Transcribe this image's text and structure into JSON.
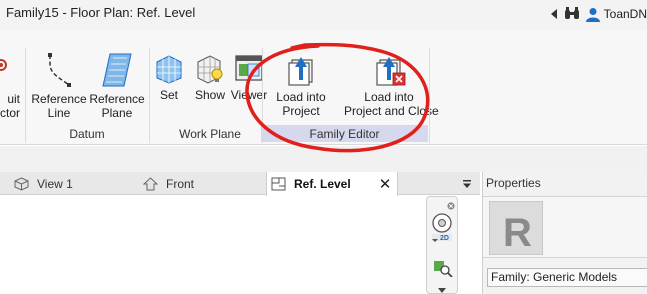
{
  "titlebar": {
    "title": "Family15 - Floor Plan: Ref. Level",
    "user_name": "ToanDN"
  },
  "ribbon": {
    "buttons": {
      "partial_a": "uit",
      "partial_b": "ctor",
      "reference_line": [
        "Reference",
        "Line"
      ],
      "reference_plane": [
        "Reference",
        "Plane"
      ],
      "set": "Set",
      "show": "Show",
      "viewer": "Viewer",
      "load_into_project": [
        "Load into",
        "Project"
      ],
      "load_into_project_and_close": [
        "Load into",
        "Project and Close"
      ]
    },
    "panels": {
      "datum": "Datum",
      "work_plane": "Work Plane",
      "family_editor": "Family Editor"
    }
  },
  "tabs": [
    {
      "label": "View 1",
      "icon": "3d-view-icon"
    },
    {
      "label": "Front",
      "icon": "elevation-icon"
    },
    {
      "label": "Ref. Level",
      "icon": "floor-plan-icon",
      "active": true
    }
  ],
  "navbar": {
    "view_2d_label": "2D"
  },
  "properties": {
    "header": "Properties",
    "type_image_letter": "R",
    "family_field": "Family: Generic Models"
  },
  "colors": {
    "annotation": "#e0201b",
    "family_editor_panel": "#d6d9ed",
    "accent_blue": "#1f6fc4"
  }
}
